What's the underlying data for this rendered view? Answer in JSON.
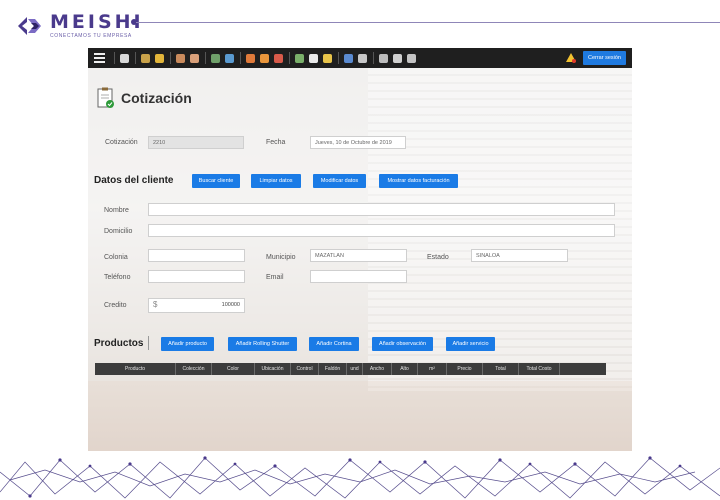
{
  "brand": {
    "name": "MEISHI",
    "tagline": "CONECTAMOS TU EMPRESA",
    "accent_color": "#4a3a8c"
  },
  "toolbar": {
    "menu_icon": "hamburger-icon",
    "icons": [
      "box-icon",
      "hammer-icon",
      "key-icon",
      "user-icon",
      "person-icon",
      "bill-icon",
      "money-icon",
      "chart-icon",
      "fire-icon",
      "tag-icon",
      "document-icon",
      "page-icon",
      "folder-icon",
      "eraser-icon",
      "pencil-icon",
      "tool-icon",
      "print-icon",
      "edit-icon"
    ],
    "warning_icon": "warning-icon",
    "logout_label": "Cerrar sesión",
    "button_color": "#1a7be6"
  },
  "page": {
    "title": "Cotización"
  },
  "quote": {
    "number_label": "Cotización",
    "number_value": "2210",
    "date_label": "Fecha",
    "date_value": "Jueves, 10 de Octubre de 2019"
  },
  "client": {
    "section_title": "Datos del cliente",
    "buttons": [
      "Buscar cliente",
      "Limpiar datos",
      "Modificar datos",
      "Mostrar datos facturación"
    ],
    "name_label": "Nombre",
    "address_label": "Domicilio",
    "colony_label": "Colonia",
    "municipality_label": "Municipio",
    "municipality_value": "MAZATLAN",
    "state_label": "Estado",
    "state_value": "SINALOA",
    "phone_label": "Teléfono",
    "email_label": "Email",
    "credit_label": "Credito",
    "credit_currency": "$",
    "credit_value": "100000"
  },
  "products": {
    "section_title": "Productos",
    "buttons": [
      "Añadir producto",
      "Añadir Rolling Shutter",
      "Añadir Cortina",
      "Añadir observación",
      "Añadir servicio"
    ],
    "columns": [
      "Producto",
      "Colección",
      "Color",
      "Ubicación",
      "Control",
      "Faldón",
      "und",
      "Ancho",
      "Alto",
      "m²",
      "Precio",
      "Total",
      "Total Costo"
    ]
  }
}
